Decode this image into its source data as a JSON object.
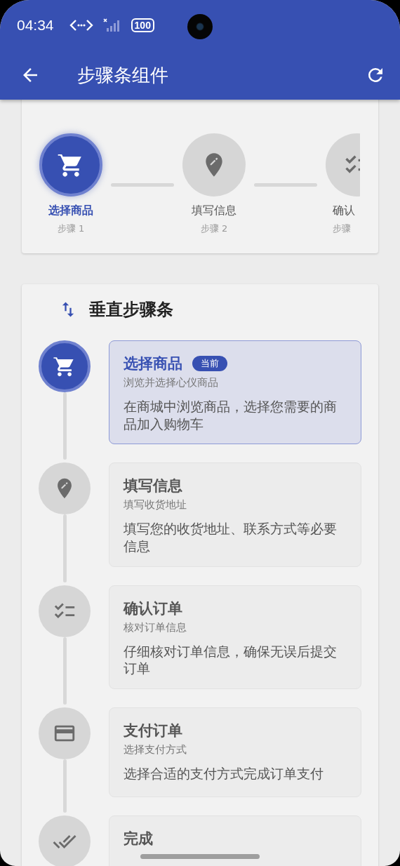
{
  "status_bar": {
    "time": "04:34",
    "battery": "100"
  },
  "app_bar": {
    "title": "步骤条组件"
  },
  "horizontal": {
    "steps": [
      {
        "label": "选择商品",
        "sub": "步骤 1",
        "selected": true
      },
      {
        "label": "填写信息",
        "sub": "步骤 2",
        "selected": false
      },
      {
        "label": "确认",
        "sub": "步骤",
        "selected": false
      }
    ]
  },
  "vertical": {
    "title": "垂直步骤条",
    "steps": [
      {
        "title": "选择商品",
        "badge": "当前",
        "subtitle": "浏览并选择心仪商品",
        "description": "在商城中浏览商品，选择您需要的商品加入购物车",
        "selected": true
      },
      {
        "title": "填写信息",
        "subtitle": "填写收货地址",
        "description": "填写您的收货地址、联系方式等必要信息",
        "selected": false
      },
      {
        "title": "确认订单",
        "subtitle": "核对订单信息",
        "description": "仔细核对订单信息，确保无误后提交订单",
        "selected": false
      },
      {
        "title": "支付订单",
        "subtitle": "选择支付方式",
        "description": "选择合适的支付方式完成订单支付",
        "selected": false
      },
      {
        "title": "完成",
        "selected": false
      }
    ]
  }
}
